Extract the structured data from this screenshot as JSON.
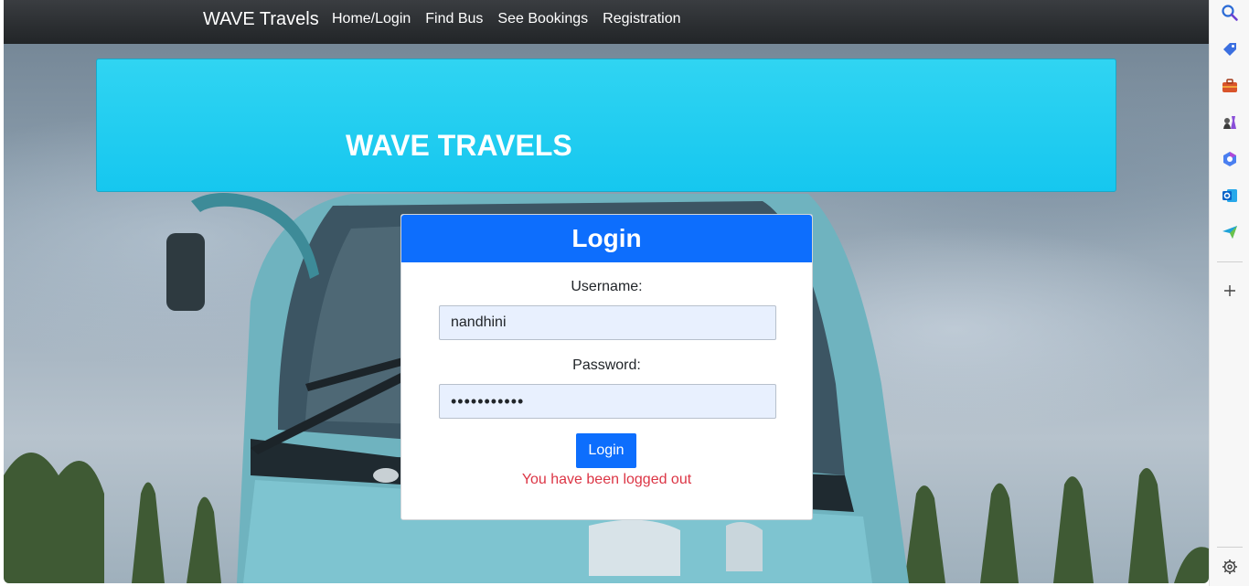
{
  "navbar": {
    "brand": "WAVE Travels",
    "links": [
      "Home/Login",
      "Find Bus",
      "See Bookings",
      "Registration"
    ]
  },
  "hero": {
    "title": "WAVE TRAVELS"
  },
  "login": {
    "heading": "Login",
    "username_label": "Username:",
    "username_value": "nandhini",
    "password_label": "Password:",
    "password_value": "nandhini123",
    "button_label": "Login",
    "message": "You have been logged out"
  },
  "sidepanel": {
    "icons": [
      "search-icon",
      "tag-icon",
      "briefcase-icon",
      "chess-icon",
      "copilot-icon",
      "outlook-icon",
      "send-icon",
      "add-icon",
      "settings-icon"
    ]
  },
  "colors": {
    "primary": "#0d6efd",
    "hero": "#1ccbef",
    "error": "#dc3545",
    "navbar": "#2b2e31"
  }
}
